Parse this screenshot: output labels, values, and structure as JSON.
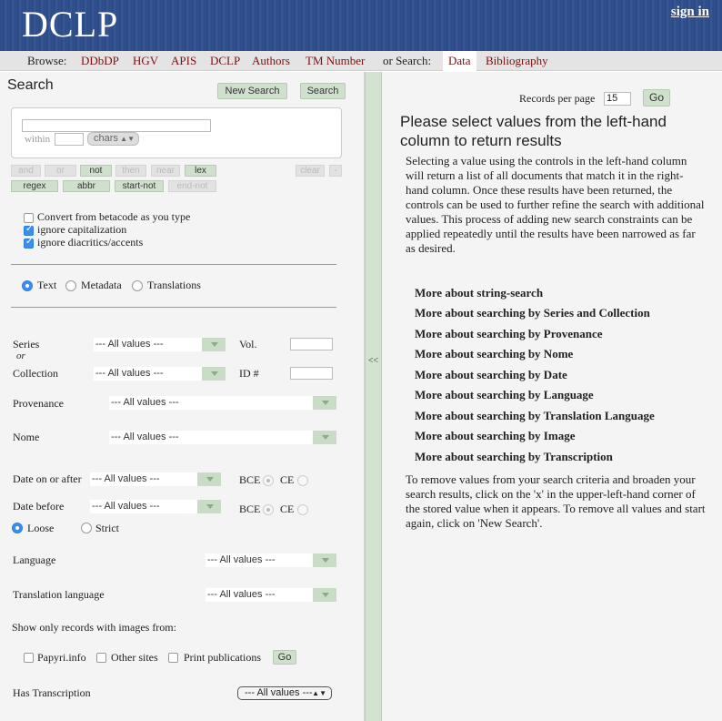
{
  "header": {
    "logo": "DCLP",
    "signin": "sign in"
  },
  "nav": {
    "browse_label": "Browse:",
    "items": [
      "DDbDP",
      "HGV",
      "APIS",
      "DCLP",
      "Authors",
      "TM Number"
    ],
    "search_label": "or Search:",
    "active": "Data",
    "bibliography": "Bibliography"
  },
  "search": {
    "title": "Search",
    "new_search": "New Search",
    "search_btn": "Search",
    "within": "within",
    "chars": "chars",
    "ops_row1": [
      "and",
      "or",
      "not",
      "then",
      "near",
      "lex",
      "clear",
      "-"
    ],
    "ops_row2": [
      "regex",
      "abbr",
      "start-not",
      "end-not"
    ],
    "options": [
      "Convert from betacode as you type",
      "ignore capitalization",
      "ignore diacritics/accents"
    ],
    "modes": [
      "Text",
      "Metadata",
      "Translations"
    ]
  },
  "filters": {
    "series": "Series",
    "or": "or",
    "collection": "Collection",
    "vol": "Vol.",
    "id": "ID #",
    "all_values": "--- All values ---",
    "provenance": "Provenance",
    "nome": "Nome",
    "date_after": "Date on or after",
    "date_before": "Date before",
    "bce": "BCE",
    "ce": "CE",
    "loose": "Loose",
    "strict": "Strict",
    "language": "Language",
    "translation_language": "Translation language",
    "images_label": "Show only records with images from:",
    "image_sources": [
      "Papyri.info",
      "Other sites",
      "Print publications"
    ],
    "go": "Go",
    "has_transcription": "Has Transcription"
  },
  "divider": "<<",
  "results": {
    "records_per_page": "Records per page",
    "records_value": "15",
    "go": "Go",
    "heading": "Please select values from the left-hand column to return results",
    "intro": "Selecting a value using the controls in the left-hand column will return a list of all documents that match it in the right-hand column. Once these results have been returned, the controls can be used to further refine the search with additional values. This process of adding new search constraints can be applied repeatedly until the results have been narrowed as far as desired.",
    "more_links": [
      "More about string-search",
      "More about searching by Series and Collection",
      "More about searching by Provenance",
      "More about searching by Nome",
      "More about searching by Date",
      "More about searching by Language",
      "More about searching by Translation Language",
      "More about searching by Image",
      "More about searching by Transcription"
    ],
    "outro": "To remove values from your search criteria and broaden your search results, click on the 'x' in the upper-left-hand corner of the stored value when it appears. To remove all values and start again, click on 'New Search'."
  }
}
